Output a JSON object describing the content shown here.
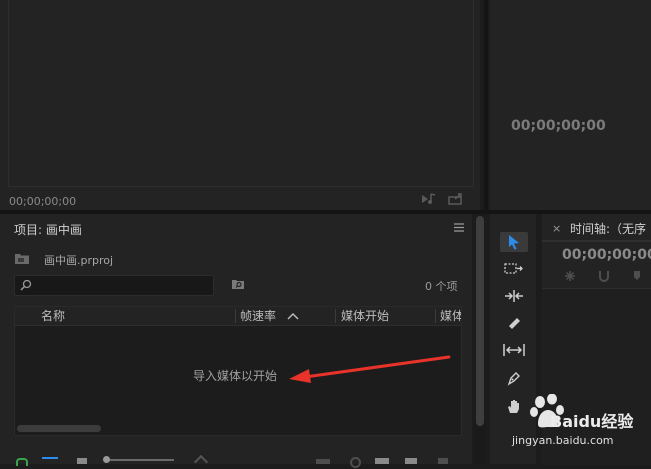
{
  "source_monitor": {
    "timecode": "00;00;00;00"
  },
  "program_monitor": {
    "timecode": "00;00;00;00"
  },
  "project_panel": {
    "title": "项目: 画中画",
    "file_name": "画中画.prproj",
    "search_placeholder": "",
    "item_count": "0 个项",
    "columns": [
      "名称",
      "帧速率",
      "媒体开始",
      "媒体"
    ],
    "empty_hint": "导入媒体以开始"
  },
  "timeline_panel": {
    "close": "×",
    "title": "时间轴:（无序",
    "timecode": "00;00;00;00"
  },
  "watermark": {
    "brand": "Baidu经验",
    "url": "jingyan.baidu.com"
  },
  "colors": {
    "accent_blue": "#2d8ceb",
    "arrow_red": "#e8332a",
    "bg": "#1c1c1c",
    "panel": "#232323"
  }
}
